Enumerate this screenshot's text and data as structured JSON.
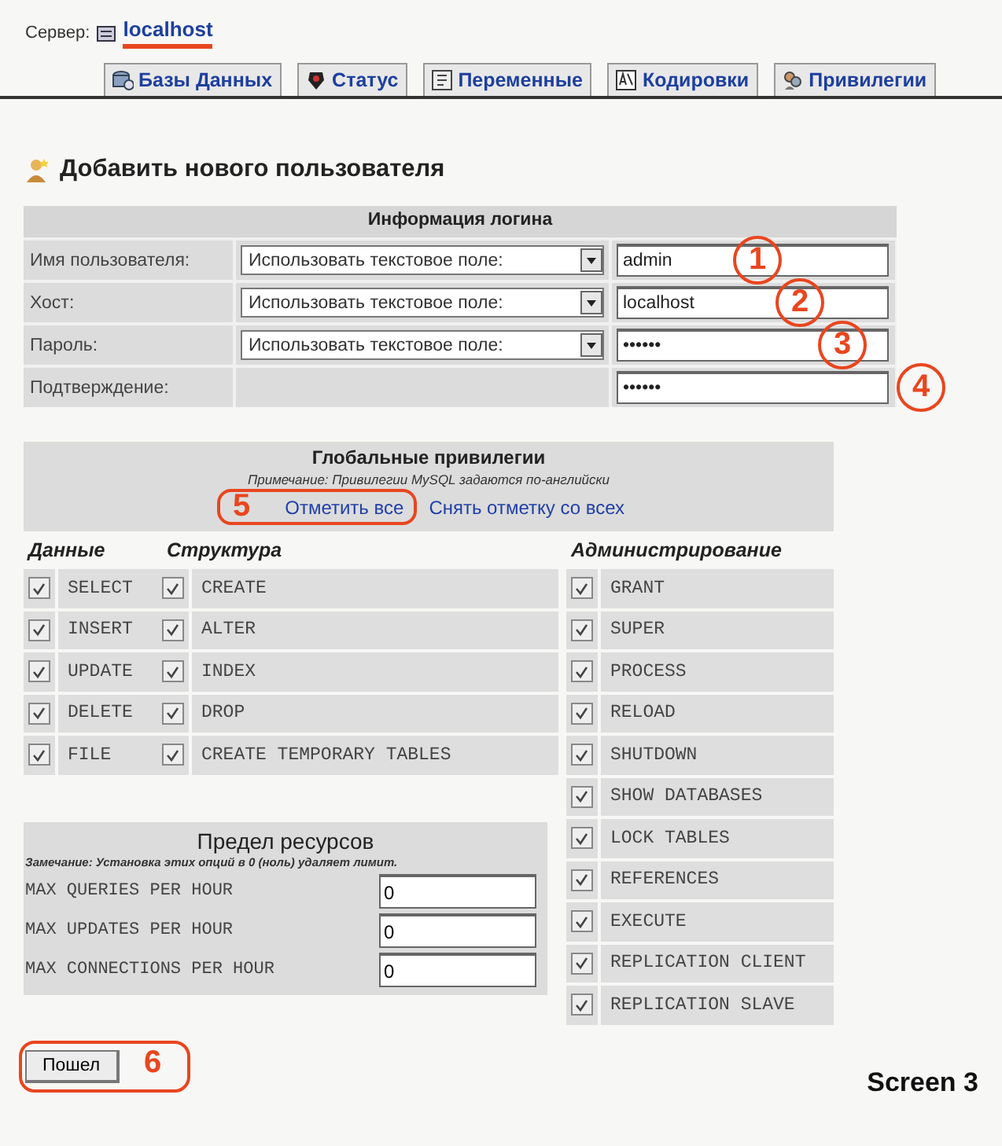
{
  "server": {
    "label": "Сервер:",
    "host": "localhost",
    "underlined": true
  },
  "tabs": [
    {
      "label": "Базы Данных",
      "selected": false
    },
    {
      "label": "Статус",
      "selected": false
    },
    {
      "label": "Переменные",
      "selected": false
    },
    {
      "label": "Кодировки",
      "selected": false
    },
    {
      "label": "Привилегии",
      "selected": false
    }
  ],
  "heading": "Добавить нового пользователя",
  "login": {
    "title": "Информация логина",
    "rows": [
      {
        "label": "Имя пользователя:",
        "select": "Использовать текстовое поле:",
        "value": "admin",
        "marker": "1"
      },
      {
        "label": "Хост:",
        "select": "Использовать текстовое поле:",
        "value": "localhost",
        "marker": "2"
      },
      {
        "label": "Пароль:",
        "select": "Использовать текстовое поле:",
        "value": "••••••",
        "marker": "3"
      },
      {
        "label": "Подтверждение:",
        "value": "••••••",
        "marker": "4"
      }
    ]
  },
  "privileges": {
    "title": "Глобальные привилегии",
    "note": "Примечание: Привилегии MySQL задаются по-английски",
    "links": [
      {
        "label": "Отметить все",
        "marker": "5"
      },
      {
        "label": "Снять отметку со всех"
      }
    ],
    "groups": [
      {
        "name": "Данные",
        "items": [
          {
            "name": "SELECT",
            "checked": true
          },
          {
            "name": "INSERT",
            "checked": true
          },
          {
            "name": "UPDATE",
            "checked": true
          },
          {
            "name": "DELETE",
            "checked": true
          },
          {
            "name": "FILE",
            "checked": true
          }
        ]
      },
      {
        "name": "Структура",
        "items": [
          {
            "name": "CREATE",
            "checked": true
          },
          {
            "name": "ALTER",
            "checked": true
          },
          {
            "name": "INDEX",
            "checked": true
          },
          {
            "name": "DROP",
            "checked": true
          },
          {
            "name": "CREATE TEMPORARY TABLES",
            "checked": true
          }
        ]
      },
      {
        "name": "Администрирование",
        "items": [
          {
            "name": "GRANT",
            "checked": true
          },
          {
            "name": "SUPER",
            "checked": true
          },
          {
            "name": "PROCESS",
            "checked": true
          },
          {
            "name": "RELOAD",
            "checked": true
          },
          {
            "name": "SHUTDOWN",
            "checked": true
          },
          {
            "name": "SHOW DATABASES",
            "checked": true
          },
          {
            "name": "LOCK TABLES",
            "checked": true
          },
          {
            "name": "REFERENCES",
            "checked": true
          },
          {
            "name": "EXECUTE",
            "checked": true
          },
          {
            "name": "REPLICATION CLIENT",
            "checked": true
          },
          {
            "name": "REPLICATION SLAVE",
            "checked": true
          }
        ]
      }
    ]
  },
  "resources": {
    "title": "Предел ресурсов",
    "note": "Замечание: Установка этих опций в 0 (ноль) удаляет лимит.",
    "rows": [
      {
        "label": "MAX QUERIES PER HOUR",
        "value": "0"
      },
      {
        "label": "MAX UPDATES PER HOUR",
        "value": "0"
      },
      {
        "label": "MAX CONNECTIONS PER HOUR",
        "value": "0"
      }
    ]
  },
  "submit": {
    "label": "Пошел",
    "marker": "6"
  },
  "caption": "Screen 3"
}
